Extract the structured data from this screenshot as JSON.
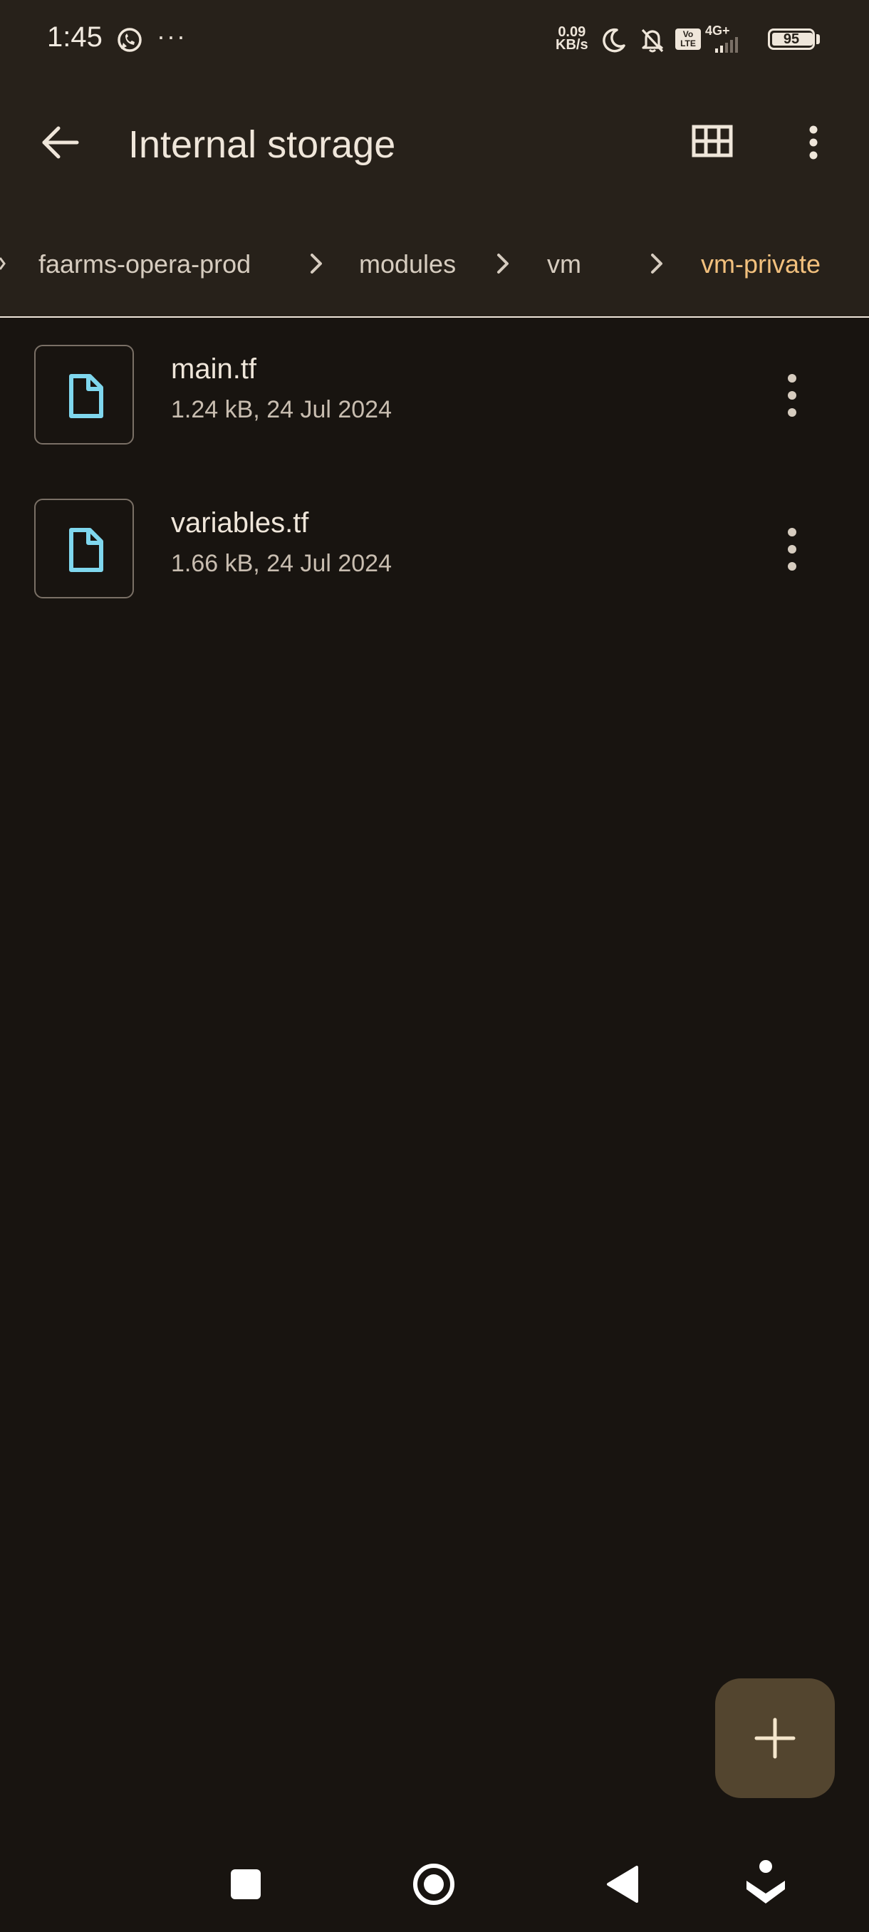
{
  "status_bar": {
    "time": "1:45",
    "net_speed_value": "0.09",
    "net_speed_unit": "KB/s",
    "network": "4G+",
    "volte": "Vo LTE",
    "battery": "95",
    "icons": [
      "whatsapp-icon",
      "more-notifications-icon",
      "moon-icon",
      "bell-off-icon",
      "volte-icon",
      "signal-icon",
      "battery-icon"
    ]
  },
  "app_bar": {
    "title": "Internal storage",
    "back_icon": "arrow-back-icon",
    "grid_icon": "grid-view-icon",
    "more_icon": "more-vert-icon"
  },
  "breadcrumb": {
    "items": [
      "faarms-opera-prod",
      "modules",
      "vm",
      "vm-private"
    ],
    "active_index": 3
  },
  "files": [
    {
      "name": "main.tf",
      "meta": "1.24 kB, 24 Jul 2024",
      "icon": "file-icon"
    },
    {
      "name": "variables.tf",
      "meta": "1.66 kB, 24 Jul 2024",
      "icon": "file-icon"
    }
  ],
  "fab": {
    "icon": "plus-icon"
  },
  "nav_bar": {
    "icons": [
      "recents-square-icon",
      "home-circle-icon",
      "back-triangle-icon",
      "accessibility-icon"
    ]
  },
  "colors": {
    "background": "#181410",
    "header": "#27211a",
    "accent_crumb": "#f2c07d",
    "file_icon": "#7fd7ee",
    "fab": "#53452f"
  }
}
